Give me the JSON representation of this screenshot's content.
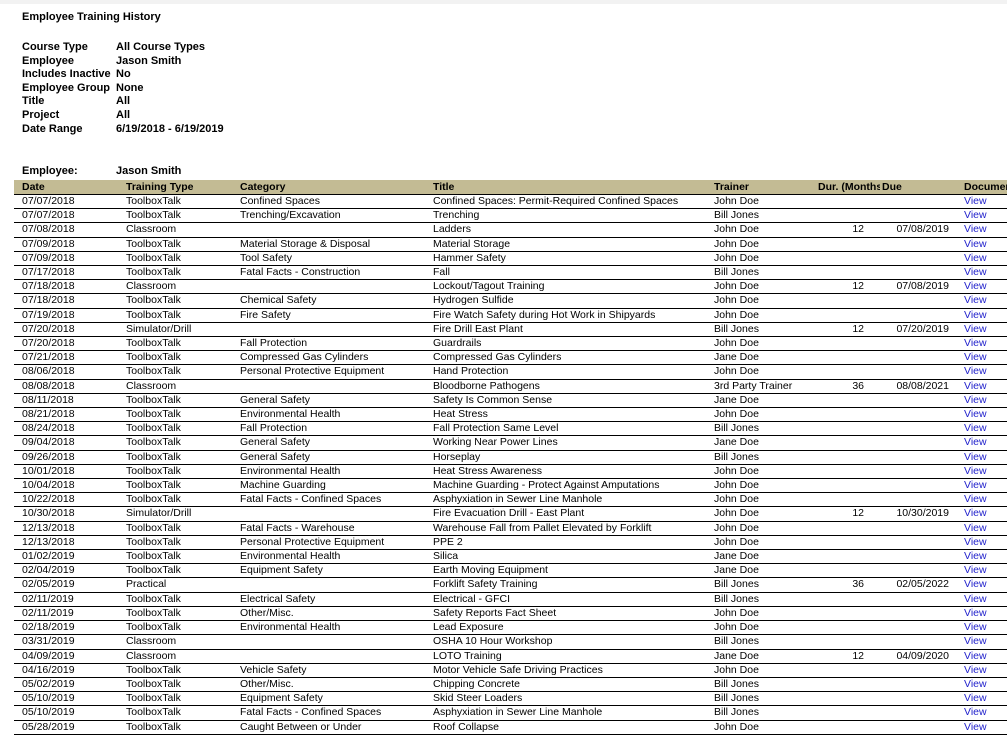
{
  "report": {
    "title": "Employee Training History"
  },
  "parameters": [
    {
      "label": "Course Type",
      "value": "All Course Types"
    },
    {
      "label": "Employee",
      "value": "Jason Smith"
    },
    {
      "label": "Includes Inactive",
      "value": "No"
    },
    {
      "label": "Employee Group",
      "value": "None"
    },
    {
      "label": "Title",
      "value": "All"
    },
    {
      "label": "Project",
      "value": "All"
    },
    {
      "label": "Date Range",
      "value": "6/19/2018 - 6/19/2019"
    }
  ],
  "employee_header": {
    "label": "Employee:",
    "value": "Jason Smith"
  },
  "table": {
    "header_background": "#c3bb94",
    "link_color": "#2222cc",
    "columns": [
      "Date",
      "Training Type",
      "Category",
      "Title",
      "Trainer",
      "Dur. (Months)",
      "Due",
      "Document"
    ],
    "document_link_label": "View",
    "rows": [
      {
        "date": "07/07/2018",
        "type": "ToolboxTalk",
        "category": "Confined Spaces",
        "title": "Confined Spaces: Permit-Required Confined Spaces",
        "trainer": "John Doe",
        "dur": "",
        "due": "",
        "document": "View"
      },
      {
        "date": "07/07/2018",
        "type": "ToolboxTalk",
        "category": "Trenching/Excavation",
        "title": "Trenching",
        "trainer": "Bill Jones",
        "dur": "",
        "due": "",
        "document": "View"
      },
      {
        "date": "07/08/2018",
        "type": "Classroom",
        "category": "",
        "title": "Ladders",
        "trainer": "John Doe",
        "dur": "12",
        "due": "07/08/2019",
        "document": "View"
      },
      {
        "date": "07/09/2018",
        "type": "ToolboxTalk",
        "category": "Material Storage & Disposal",
        "title": "Material Storage",
        "trainer": "John Doe",
        "dur": "",
        "due": "",
        "document": "View"
      },
      {
        "date": "07/09/2018",
        "type": "ToolboxTalk",
        "category": "Tool Safety",
        "title": "Hammer Safety",
        "trainer": "John Doe",
        "dur": "",
        "due": "",
        "document": "View"
      },
      {
        "date": "07/17/2018",
        "type": "ToolboxTalk",
        "category": "Fatal Facts - Construction",
        "title": "Fall",
        "trainer": "Bill Jones",
        "dur": "",
        "due": "",
        "document": "View"
      },
      {
        "date": "07/18/2018",
        "type": "Classroom",
        "category": "",
        "title": "Lockout/Tagout Training",
        "trainer": "John Doe",
        "dur": "12",
        "due": "07/08/2019",
        "document": "View"
      },
      {
        "date": "07/18/2018",
        "type": "ToolboxTalk",
        "category": "Chemical Safety",
        "title": "Hydrogen Sulfide",
        "trainer": "John Doe",
        "dur": "",
        "due": "",
        "document": "View"
      },
      {
        "date": "07/19/2018",
        "type": "ToolboxTalk",
        "category": "Fire Safety",
        "title": "Fire Watch Safety during Hot Work in Shipyards",
        "trainer": "John Doe",
        "dur": "",
        "due": "",
        "document": "View"
      },
      {
        "date": "07/20/2018",
        "type": "Simulator/Drill",
        "category": "",
        "title": "Fire Drill East Plant",
        "trainer": "Bill Jones",
        "dur": "12",
        "due": "07/20/2019",
        "document": "View"
      },
      {
        "date": "07/20/2018",
        "type": "ToolboxTalk",
        "category": "Fall Protection",
        "title": "Guardrails",
        "trainer": "John Doe",
        "dur": "",
        "due": "",
        "document": "View"
      },
      {
        "date": "07/21/2018",
        "type": "ToolboxTalk",
        "category": "Compressed Gas Cylinders",
        "title": "Compressed Gas Cylinders",
        "trainer": "Jane Doe",
        "dur": "",
        "due": "",
        "document": "View"
      },
      {
        "date": "08/06/2018",
        "type": "ToolboxTalk",
        "category": "Personal Protective Equipment",
        "title": "Hand Protection",
        "trainer": "John Doe",
        "dur": "",
        "due": "",
        "document": "View"
      },
      {
        "date": "08/08/2018",
        "type": "Classroom",
        "category": "",
        "title": "Bloodborne Pathogens",
        "trainer": "3rd Party Trainer",
        "dur": "36",
        "due": "08/08/2021",
        "document": "View"
      },
      {
        "date": "08/11/2018",
        "type": "ToolboxTalk",
        "category": "General Safety",
        "title": "Safety Is Common Sense",
        "trainer": "Jane Doe",
        "dur": "",
        "due": "",
        "document": "View"
      },
      {
        "date": "08/21/2018",
        "type": "ToolboxTalk",
        "category": "Environmental Health",
        "title": "Heat Stress",
        "trainer": "John Doe",
        "dur": "",
        "due": "",
        "document": "View"
      },
      {
        "date": "08/24/2018",
        "type": "ToolboxTalk",
        "category": "Fall Protection",
        "title": "Fall Protection Same Level",
        "trainer": "Bill Jones",
        "dur": "",
        "due": "",
        "document": "View"
      },
      {
        "date": "09/04/2018",
        "type": "ToolboxTalk",
        "category": "General Safety",
        "title": "Working Near Power Lines",
        "trainer": "Jane Doe",
        "dur": "",
        "due": "",
        "document": "View"
      },
      {
        "date": "09/26/2018",
        "type": "ToolboxTalk",
        "category": "General Safety",
        "title": "Horseplay",
        "trainer": "Bill Jones",
        "dur": "",
        "due": "",
        "document": "View"
      },
      {
        "date": "10/01/2018",
        "type": "ToolboxTalk",
        "category": "Environmental Health",
        "title": "Heat Stress Awareness",
        "trainer": "John Doe",
        "dur": "",
        "due": "",
        "document": "View"
      },
      {
        "date": "10/04/2018",
        "type": "ToolboxTalk",
        "category": "Machine Guarding",
        "title": "Machine Guarding - Protect Against Amputations",
        "trainer": "John Doe",
        "dur": "",
        "due": "",
        "document": "View"
      },
      {
        "date": "10/22/2018",
        "type": "ToolboxTalk",
        "category": "Fatal Facts - Confined Spaces",
        "title": "Asphyxiation in Sewer Line Manhole",
        "trainer": "John Doe",
        "dur": "",
        "due": "",
        "document": "View"
      },
      {
        "date": "10/30/2018",
        "type": "Simulator/Drill",
        "category": "",
        "title": "Fire Evacuation Drill - East Plant",
        "trainer": "John Doe",
        "dur": "12",
        "due": "10/30/2019",
        "document": "View"
      },
      {
        "date": "12/13/2018",
        "type": "ToolboxTalk",
        "category": "Fatal Facts - Warehouse",
        "title": "Warehouse Fall from Pallet Elevated by Forklift",
        "trainer": "John Doe",
        "dur": "",
        "due": "",
        "document": "View"
      },
      {
        "date": "12/13/2018",
        "type": "ToolboxTalk",
        "category": "Personal Protective Equipment",
        "title": "PPE 2",
        "trainer": "John Doe",
        "dur": "",
        "due": "",
        "document": "View"
      },
      {
        "date": "01/02/2019",
        "type": "ToolboxTalk",
        "category": "Environmental Health",
        "title": "Silica",
        "trainer": "Jane Doe",
        "dur": "",
        "due": "",
        "document": "View"
      },
      {
        "date": "02/04/2019",
        "type": "ToolboxTalk",
        "category": "Equipment Safety",
        "title": "Earth Moving Equipment",
        "trainer": "Jane Doe",
        "dur": "",
        "due": "",
        "document": "View"
      },
      {
        "date": "02/05/2019",
        "type": "Practical",
        "category": "",
        "title": "Forklift Safety Training",
        "trainer": "Bill Jones",
        "dur": "36",
        "due": "02/05/2022",
        "document": "View"
      },
      {
        "date": "02/11/2019",
        "type": "ToolboxTalk",
        "category": "Electrical Safety",
        "title": "Electrical - GFCI",
        "trainer": "Bill Jones",
        "dur": "",
        "due": "",
        "document": "View"
      },
      {
        "date": "02/11/2019",
        "type": "ToolboxTalk",
        "category": "Other/Misc.",
        "title": "Safety Reports Fact Sheet",
        "trainer": "John Doe",
        "dur": "",
        "due": "",
        "document": "View"
      },
      {
        "date": "02/18/2019",
        "type": "ToolboxTalk",
        "category": "Environmental Health",
        "title": "Lead Exposure",
        "trainer": "John Doe",
        "dur": "",
        "due": "",
        "document": "View"
      },
      {
        "date": "03/31/2019",
        "type": "Classroom",
        "category": "",
        "title": "OSHA 10 Hour Workshop",
        "trainer": "Bill Jones",
        "dur": "",
        "due": "",
        "document": "View"
      },
      {
        "date": "04/09/2019",
        "type": "Classroom",
        "category": "",
        "title": "LOTO Training",
        "trainer": "Jane Doe",
        "dur": "12",
        "due": "04/09/2020",
        "document": "View"
      },
      {
        "date": "04/16/2019",
        "type": "ToolboxTalk",
        "category": "Vehicle Safety",
        "title": "Motor Vehicle Safe Driving Practices",
        "trainer": "John Doe",
        "dur": "",
        "due": "",
        "document": "View"
      },
      {
        "date": "05/02/2019",
        "type": "ToolboxTalk",
        "category": "Other/Misc.",
        "title": "Chipping Concrete",
        "trainer": "Bill Jones",
        "dur": "",
        "due": "",
        "document": "View"
      },
      {
        "date": "05/10/2019",
        "type": "ToolboxTalk",
        "category": "Equipment Safety",
        "title": "Skid Steer Loaders",
        "trainer": "Bill Jones",
        "dur": "",
        "due": "",
        "document": "View"
      },
      {
        "date": "05/10/2019",
        "type": "ToolboxTalk",
        "category": "Fatal Facts - Confined Spaces",
        "title": "Asphyxiation in Sewer Line Manhole",
        "trainer": "Bill Jones",
        "dur": "",
        "due": "",
        "document": "View"
      },
      {
        "date": "05/28/2019",
        "type": "ToolboxTalk",
        "category": "Caught Between or Under",
        "title": "Roof Collapse",
        "trainer": "John Doe",
        "dur": "",
        "due": "",
        "document": "View"
      }
    ]
  }
}
